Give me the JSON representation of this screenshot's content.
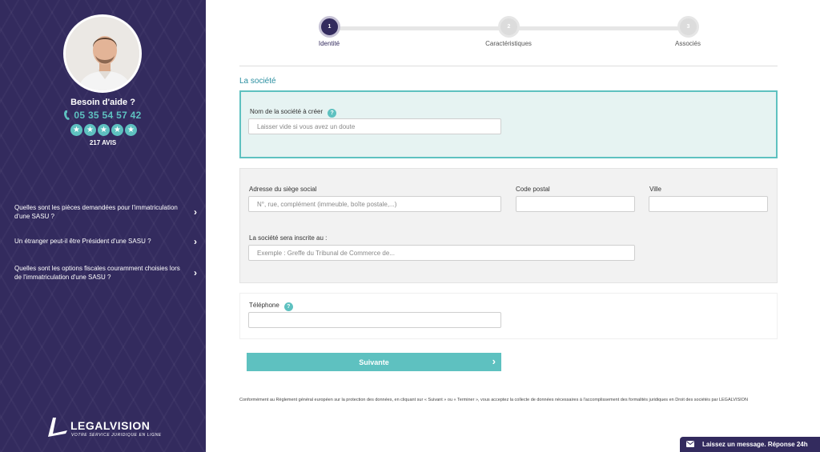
{
  "sidebar": {
    "help_title": "Besoin d'aide ?",
    "phone": "05 35 54 57 42",
    "rating_count": "217 AVIS",
    "stars": 5,
    "faq": [
      {
        "question": "Quelles sont les pièces demandées pour l'immatriculation d'une SASU ?"
      },
      {
        "question": "Un étranger peut-il être Président d'une SASU ?"
      },
      {
        "question": "Quelles sont les options fiscales couramment choisies lors de l'immatriculation d'une SASU ?"
      }
    ],
    "logo_text": "LEGALVISION",
    "logo_tagline": "VOTRE SERVICE JURIDIQUE EN LIGNE"
  },
  "stepper": {
    "current": 1,
    "steps": [
      {
        "number": "1",
        "label": "Identité"
      },
      {
        "number": "2",
        "label": "Caractéristiques"
      },
      {
        "number": "3",
        "label": "Associés"
      }
    ]
  },
  "form": {
    "section_title": "La société",
    "company_name": {
      "label": "Nom de la société à créer",
      "placeholder": "Laisser vide si vous avez un doute",
      "value": ""
    },
    "address": {
      "label": "Adresse du siège social",
      "placeholder": "N°, rue, complément (immeuble, boîte postale,...)",
      "value": ""
    },
    "postal_code": {
      "label": "Code postal",
      "placeholder": "",
      "value": ""
    },
    "city": {
      "label": "Ville",
      "placeholder": "",
      "value": ""
    },
    "registry": {
      "label": "La société sera inscrite au :",
      "placeholder": "Exemple : Greffe du Tribunal de Commerce de...",
      "value": ""
    },
    "phone": {
      "label": "Téléphone",
      "placeholder": "",
      "value": ""
    },
    "next_button": "Suivante",
    "legal_notice": "Conformément au Règlement général européen sur la protection des données, en cliquant sur « Suivant » ou « Terminer », vous acceptez la collecte de données nécessaires à l'accomplissement des formalités juridiques en Droit des sociétés par LEGALVISION"
  },
  "chat": {
    "label": "Laissez un message. Réponse 24h"
  },
  "colors": {
    "primary": "#332b5e",
    "accent": "#5ec1c0",
    "title": "#2b8fa1"
  }
}
